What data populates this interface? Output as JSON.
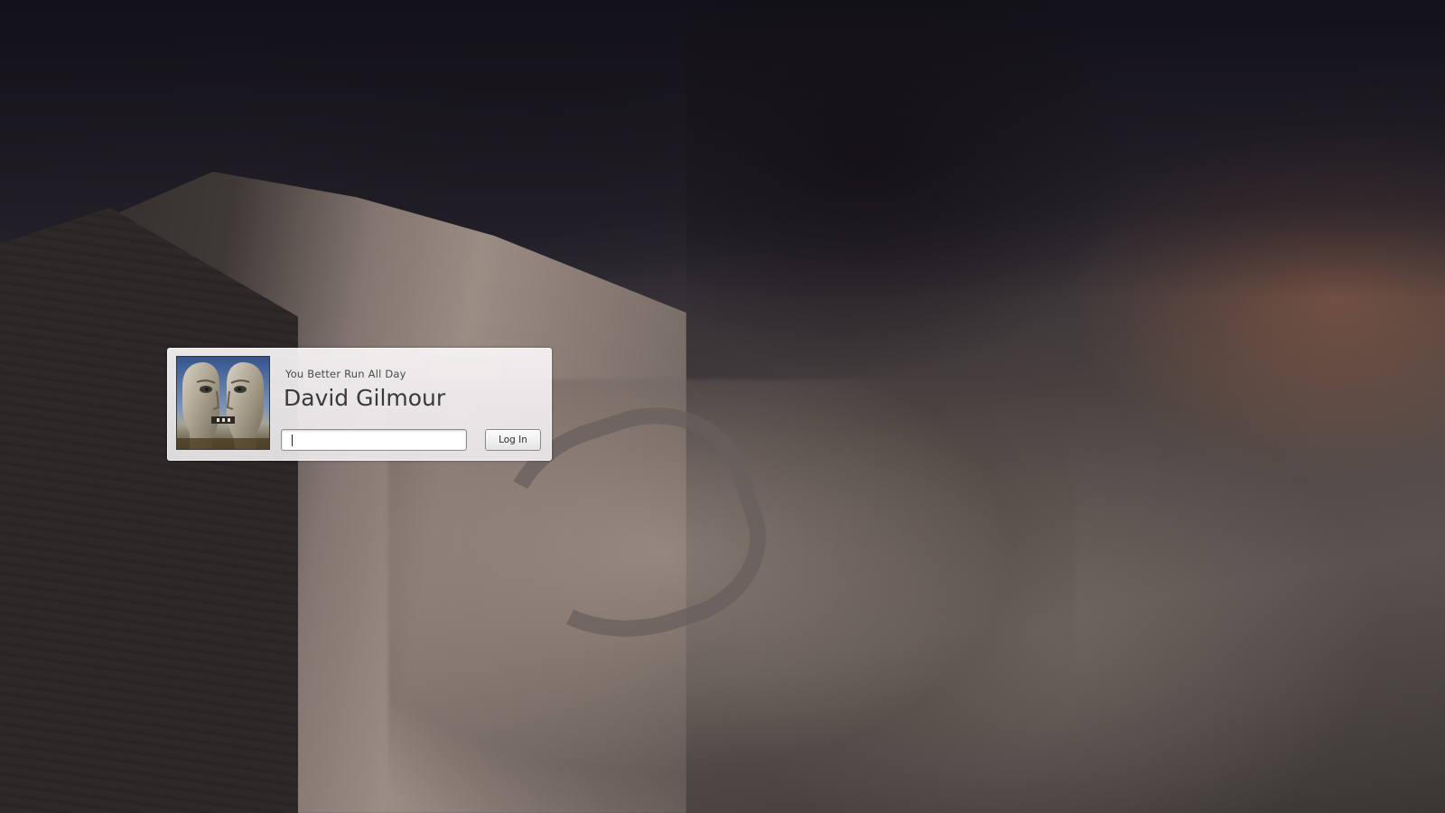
{
  "greeter": {
    "subtitle": "You Better Run All Day",
    "username": "David Gilmour",
    "password_value": "",
    "login_label": "Log In",
    "avatar_icon": "user-avatar-icon"
  },
  "colors": {
    "panel_background": "#f1eef0",
    "text": "#3a3a3a",
    "button_border": "#8a8a8a"
  }
}
